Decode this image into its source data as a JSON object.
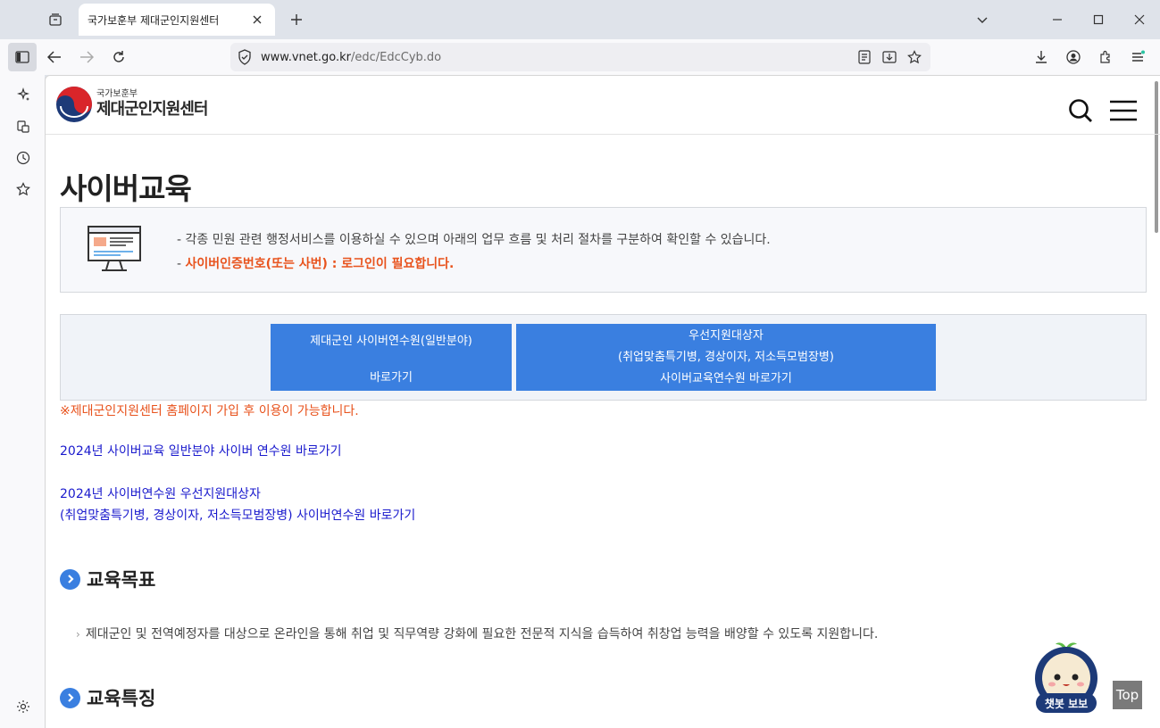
{
  "browser": {
    "tab_title": "국가보훈부 제대군인지원센터",
    "url_host": "www.vnet.go.kr",
    "url_path": "/edc/EdcCyb.do"
  },
  "site": {
    "logo_small": "국가보훈부",
    "logo_big": "제대군인지원센터"
  },
  "page": {
    "title": "사이버교육",
    "notice_line1": "- 각종 민원 관련 행정서비스를 이용하실 수 있으며 아래의 업무 흐름 및 처리 절차를 구분하여 확인할 수 있습니다.",
    "notice_line2_dash": "- ",
    "notice_line2": "사이버인증번호(또는 사번) : 로그인이 필요합니다.",
    "btn_general_l1": "제대군인 사이버연수원(일반분야)",
    "btn_general_l2": "바로가기",
    "btn_priority_l1": "우선지원대상자",
    "btn_priority_l2": "(취업맞춤특기병, 경상이자, 저소득모범장병)",
    "btn_priority_l3": "사이버교육연수원 바로가기",
    "signup_note": "※제대군인지원센터 홈페이지 가입 후 이용이 가능합니다.",
    "link1": "2024년 사이버교육 일반분야 사이버 연수원 바로가기",
    "link2_l1": "2024년 사이버연수원 우선지원대상자",
    "link2_l2": "(취업맞춤특기병, 경상이자, 저소득모범장병) 사이버연수원 바로가기",
    "section1_title": "교육목표",
    "section1_desc": "제대군인 및 전역예정자를 대상으로 온라인을 통해 취업 및 직무역량 강화에 필요한 전문적 지식을 습득하여 취창업 능력을 배양할 수 있도록 지원합니다.",
    "section2_title": "교육특징",
    "chatbot_label": "챗봇 보보",
    "top_label": "Top"
  },
  "colors": {
    "accent_blue": "#3a7fe0",
    "warning_orange": "#e8531d",
    "link_blue": "#1a1acd"
  }
}
